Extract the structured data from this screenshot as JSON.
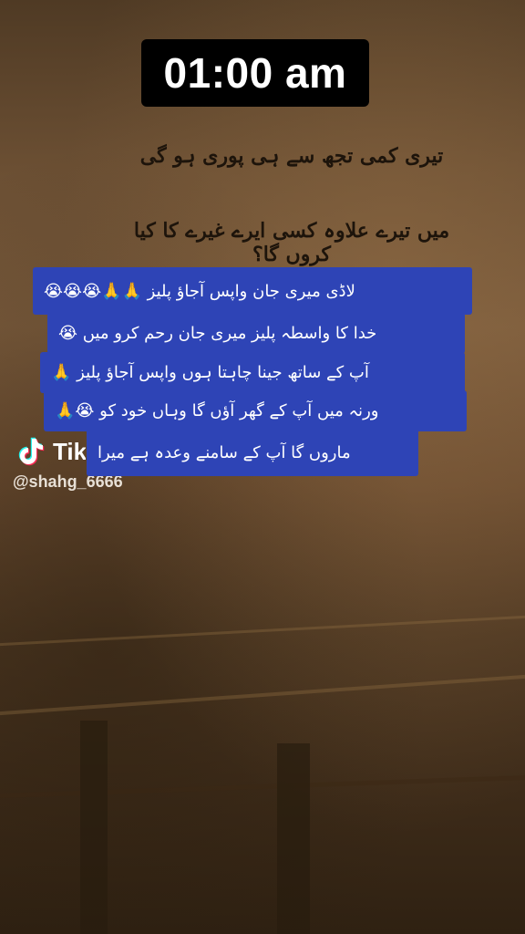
{
  "clock": {
    "time": "01:00 am"
  },
  "poetry": {
    "line1": "تیری کمی تجھ سے ہی پوری ہو گی",
    "line2": "میں تیرے علاوہ کسی ایرے غیرے کا کیا کروں گا؟"
  },
  "caption": {
    "lines": [
      "لاڈی میری جان واپس آجاؤ پلیز 🙏🙏😭😭😭",
      "خدا کا واسطہ پلیز میری جان رحم کرو میں 😭",
      "آپ کے ساتھ جینا چاہتا ہوں واپس آجاؤ پلیز 🙏",
      "ورنہ میں آپ کے گھر آؤں گا وہاں خود کو 😭🙏",
      "ماروں گا آپ کے سامنے وعدہ ہے میرا"
    ]
  },
  "watermark": {
    "brand": "TikTok",
    "handle": "@shahg_6666",
    "icon": "tiktok-icon"
  },
  "colors": {
    "caption_bg": "#2e44b6",
    "clock_bg": "#000000",
    "clock_text": "#ffffff",
    "poetry_text": "#1d140b"
  }
}
